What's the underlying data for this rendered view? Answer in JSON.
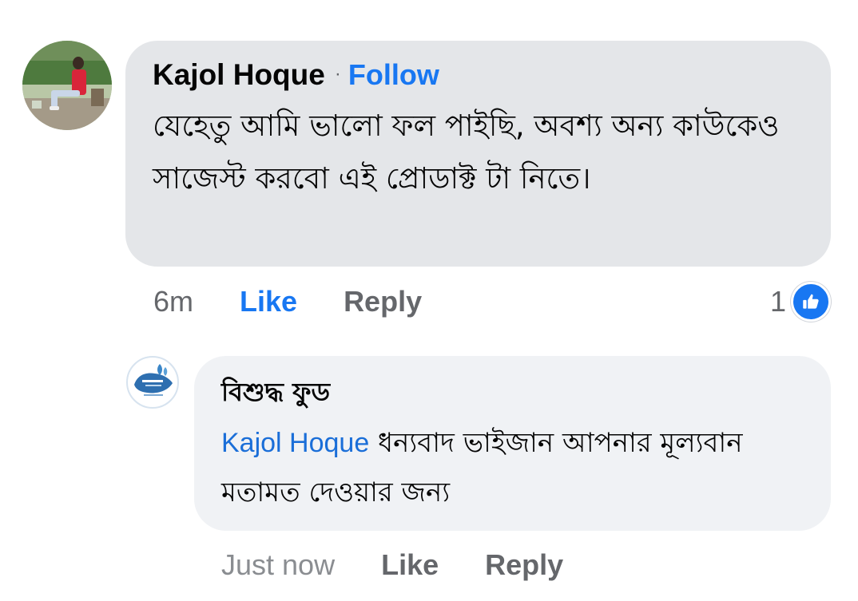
{
  "comment": {
    "author": "Kajol Hoque",
    "separator": "·",
    "follow_label": "Follow",
    "text": "যেহেতু আমি ভালো ফল পাইছি, অবশ্য  অন্য কাউকেও সাজেস্ট  করবো এই প্রোডাক্ট টা নিতে।",
    "timestamp": "6m",
    "like_label": "Like",
    "like_active": true,
    "reply_label": "Reply",
    "reaction_count": "1",
    "reaction_icon": "thumbs-up-icon",
    "accent_color": "#1877f2"
  },
  "reply": {
    "author": "বিশুদ্ধ ফুড",
    "mention": "Kajol Hoque",
    "text": " ধন্যবাদ ভাইজান আপনার মূল্যবান মতামত দেওয়ার জন্য",
    "timestamp": "Just now",
    "like_label": "Like",
    "reply_label": "Reply"
  }
}
